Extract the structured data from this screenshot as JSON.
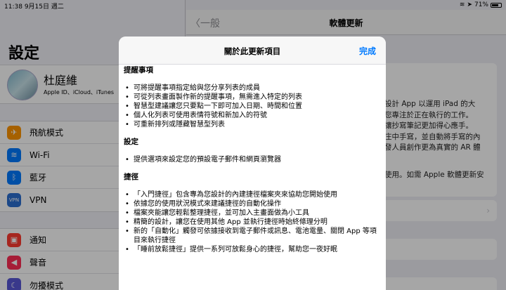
{
  "status": {
    "time": "11:38",
    "date": "9月15日 週二",
    "battery": "71%"
  },
  "sidebar": {
    "title": "設定",
    "profile": {
      "name": "杜庭維",
      "subtitle": "Apple ID、iCloud、iTunes"
    },
    "group1": [
      {
        "label": "飛航模式",
        "icon": "airplane-icon",
        "color": "#ff9500",
        "glyph": "✈"
      },
      {
        "label": "Wi-Fi",
        "icon": "wifi-icon",
        "color": "#007aff",
        "glyph": "≋"
      },
      {
        "label": "藍牙",
        "icon": "bluetooth-icon",
        "color": "#007aff",
        "glyph": "ᛒ"
      },
      {
        "label": "VPN",
        "icon": "vpn-icon",
        "color": "#2c6fd1",
        "glyph": "VPN"
      }
    ],
    "group2": [
      {
        "label": "通知",
        "icon": "notifications-icon",
        "color": "#ff3b30",
        "glyph": "▣"
      },
      {
        "label": "聲音",
        "icon": "sound-icon",
        "color": "#ff2d55",
        "glyph": "◀"
      },
      {
        "label": "勿擾模式",
        "icon": "moon-icon",
        "color": "#5856d6",
        "glyph": "☾"
      }
    ]
  },
  "detail": {
    "back": "一般",
    "title": "軟體更新",
    "bg_lines": [
      "設計 App 以運用 iPad 的大",
      "您專注於正在執行的工作。",
      "讓抄寫筆記更加得心應手。",
      "庄中手寫，並自動將手寫的內",
      "發人員創作更為真實的 AR 體"
    ],
    "bg_line2": "使用。如需 Apple 軟體更新安"
  },
  "modal": {
    "title": "關於此更新項目",
    "done": "完成",
    "sections": [
      {
        "heading": "提醒事項",
        "items": [
          "可將提醒事項指定給與您分享列表的成員",
          "可從列表畫面製作新的提醒事項，無需進入特定的列表",
          "智慧型建議讓您只要點一下即可加入日期、時間和位置",
          "個人化列表可使用表情符號和新加入的符號",
          "可重新排列或隱藏智慧型列表"
        ]
      },
      {
        "heading": "設定",
        "items": [
          "提供選項來設定您的預設電子郵件和網頁瀏覽器"
        ]
      },
      {
        "heading": "捷徑",
        "items": [
          "「入門捷徑」包含專為您設計的內建捷徑檔案夾來協助您開始使用",
          "依據您的使用狀況模式來建議捷徑的自動化操作",
          "檔案夾能讓您輕鬆整理捷徑，並可加入主畫面做為小工具",
          "精簡的設計，讓您在使用其他 App 並執行捷徑時始終條理分明",
          "新的「自動化」觸發可依據接收到電子郵件或訊息、電池電量、關閉 App 等項目來執行捷徑",
          "「睡前放鬆捷徑」提供一系列可放鬆身心的捷徑，幫助您一夜好眠"
        ]
      }
    ]
  }
}
